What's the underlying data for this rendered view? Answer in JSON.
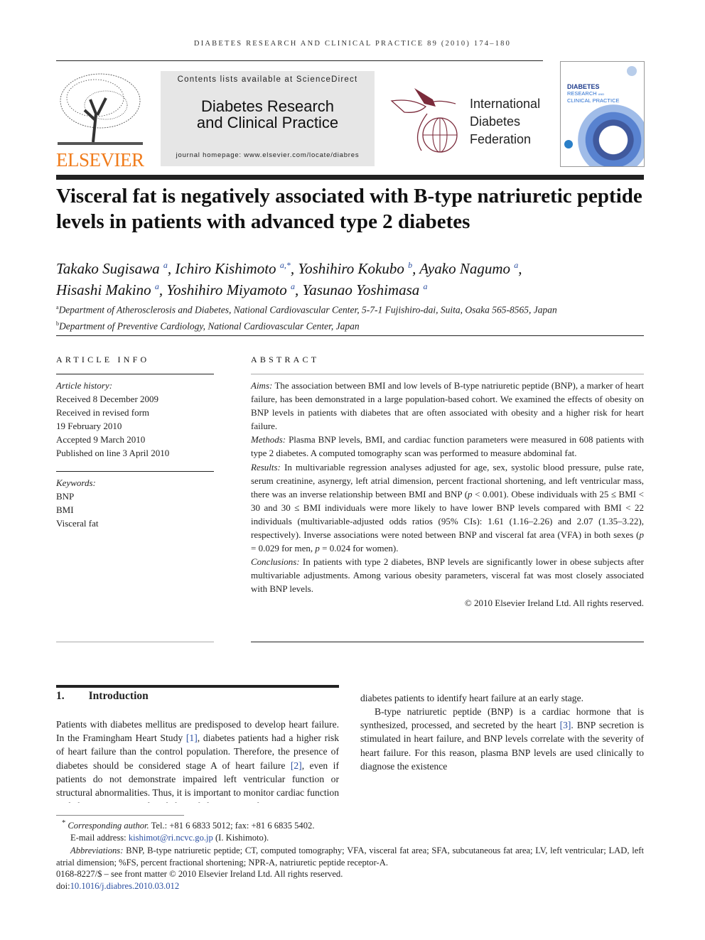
{
  "running_header": "DIABETES RESEARCH AND CLINICAL PRACTICE 89 (2010) 174–180",
  "masthead": {
    "publisher_logo": "ELSEVIER",
    "contents_line": "Contents lists available at ScienceDirect",
    "journal_name_line1": "Diabetes Research",
    "journal_name_line2": "and Clinical Practice",
    "homepage": "journal homepage: www.elsevier.com/locate/diabres",
    "partner_logo": [
      "International",
      "Diabetes",
      "Federation"
    ],
    "cover": {
      "title1": "DIABETES",
      "title2": "RESEARCH",
      "title2b": "AND",
      "title3": "CLINICAL PRACTICE"
    },
    "colors": {
      "elsevier_orange": "#f07c1c",
      "idf_maroon": "#7b2b3b",
      "cover_blue": "#1e3c8c"
    }
  },
  "article": {
    "title": "Visceral fat is negatively associated with B-type natriuretic peptide levels in patients with advanced type 2 diabetes",
    "authors": [
      {
        "name": "Takako Sugisawa",
        "aff": "a"
      },
      {
        "name": "Ichiro Kishimoto",
        "aff": "a,*"
      },
      {
        "name": "Yoshihiro Kokubo",
        "aff": "b"
      },
      {
        "name": "Ayako Nagumo",
        "aff": "a"
      },
      {
        "name": "Hisashi Makino",
        "aff": "a"
      },
      {
        "name": "Yoshihiro Miyamoto",
        "aff": "a"
      },
      {
        "name": "Yasunao Yoshimasa",
        "aff": "a"
      }
    ],
    "affiliations": [
      {
        "mark": "a",
        "text": "Department of Atherosclerosis and Diabetes, National Cardiovascular Center, 5-7-1 Fujishiro-dai, Suita, Osaka 565-8565, Japan"
      },
      {
        "mark": "b",
        "text": "Department of Preventive Cardiology, National Cardiovascular Center, Japan"
      }
    ]
  },
  "article_info": {
    "heading": "ARTICLE INFO",
    "history_label": "Article history:",
    "history": [
      "Received 8 December 2009",
      "Received in revised form",
      "19 February 2010",
      "Accepted 9 March 2010",
      "Published on line 3 April 2010"
    ],
    "keywords_label": "Keywords:",
    "keywords": [
      "BNP",
      "BMI",
      "Visceral fat"
    ]
  },
  "abstract": {
    "heading": "ABSTRACT",
    "aims_label": "Aims:",
    "aims": "The association between BMI and low levels of B-type natriuretic peptide (BNP), a marker of heart failure, has been demonstrated in a large population-based cohort. We examined the effects of obesity on BNP levels in patients with diabetes that are often associated with obesity and a higher risk for heart failure.",
    "methods_label": "Methods:",
    "methods": "Plasma BNP levels, BMI, and cardiac function parameters were measured in 608 patients with type 2 diabetes. A computed tomography scan was performed to measure abdominal fat.",
    "results_label": "Results:",
    "results_1": "In multivariable regression analyses adjusted for age, sex, systolic blood pressure, pulse rate, serum creatinine, asynergy, left atrial dimension, percent fractional shortening, and left ventricular mass, there was an inverse relationship between BMI and BNP (",
    "p": "p",
    "results_2": " < 0.001). Obese individuals with 25 ≤ BMI < 30 and 30 ≤ BMI individuals were more likely to have lower BNP levels compared with BMI < 22 individuals (multivariable-adjusted odds ratios (95% CIs): 1.61 (1.16–2.26) and 2.07 (1.35–3.22), respectively). Inverse associations were noted between BNP and visceral fat area (VFA) in both sexes (",
    "results_3": " = 0.029 for men, ",
    "results_4": " = 0.024 for women).",
    "conclusions_label": "Conclusions:",
    "conclusions": "In patients with type 2 diabetes, BNP levels are significantly lower in obese subjects after multivariable adjustments. Among various obesity parameters, visceral fat was most closely associated with BNP levels.",
    "copyright": "© 2010 Elsevier Ireland Ltd. All rights reserved."
  },
  "introduction": {
    "number": "1.",
    "heading": "Introduction",
    "p1_a": "Patients with diabetes mellitus are predisposed to develop heart failure. In the Framingham Heart Study ",
    "ref1": "[1]",
    "p1_b": ", diabetes patients had a higher risk of heart failure than the control population. Therefore, the presence of diabetes should be considered stage A of heart failure ",
    "ref2": "[2]",
    "p1_c": ", even if patients do not demonstrate impaired left ventricular function or structural abnormalities. Thus, it is important to monitor cardiac function in diabetes patients to identify heart failure at an early stage.",
    "p2_a": "B-type natriuretic peptide (BNP) is a cardiac hormone that is synthesized, processed, and secreted by the heart ",
    "ref3": "[3]",
    "p2_b": ". BNP secretion is stimulated in heart failure, and BNP levels correlate with the severity of heart failure. For this reason, plasma BNP levels are used clinically to diagnose the existence"
  },
  "footnotes": {
    "star": "*",
    "corr_label": "Corresponding author.",
    "corr_text": " Tel.: +81 6 6833 5012; fax: +81 6 6835 5402.",
    "email_label": "E-mail address: ",
    "email": "kishimot@ri.ncvc.go.jp",
    "email_after": " (I. Kishimoto).",
    "abbr_label": "Abbreviations:",
    "abbr_text": " BNP, B-type natriuretic peptide; CT, computed tomography; VFA, visceral fat area; SFA, subcutaneous fat area; LV, left ventricular; LAD, left atrial dimension; %FS, percent fractional shortening; NPR-A, natriuretic peptide receptor-A.",
    "issn": "0168-8227/$ – see front matter © 2010 Elsevier Ireland Ltd. All rights reserved.",
    "doi_label": "doi:",
    "doi": "10.1016/j.diabres.2010.03.012"
  }
}
